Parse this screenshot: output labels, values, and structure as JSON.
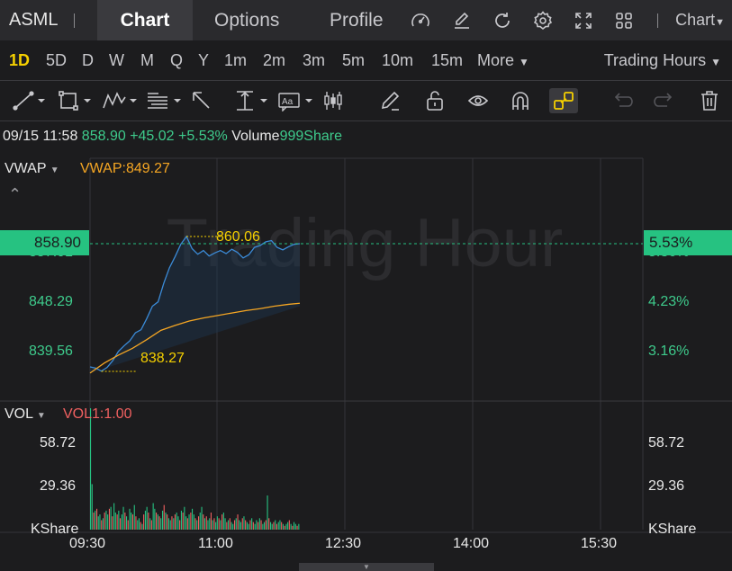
{
  "header": {
    "ticker": "ASML",
    "tabs": [
      "Chart",
      "Options",
      "Profile"
    ],
    "chart_type_label": "Chart",
    "icons": [
      "speedometer-icon",
      "pen-edit-icon",
      "refresh-icon",
      "gear-icon",
      "expand-icon",
      "grid-icon"
    ]
  },
  "periods": {
    "items": [
      "1D",
      "5D",
      "D",
      "W",
      "M",
      "Q",
      "Y",
      "1m",
      "2m",
      "3m",
      "5m",
      "10m",
      "15m",
      "More"
    ],
    "active": "1D",
    "hours_label": "Trading Hours"
  },
  "drawing_tools": [
    "trend-line-icon",
    "rectangle-icon",
    "wave-pattern-icon",
    "fibonacci-icon",
    "arrow-icon",
    "price-range-icon",
    "text-label-icon",
    "candlestick-icon",
    "pencil-icon",
    "unlock-icon",
    "eye-icon",
    "magnet-icon",
    "link-icon",
    "undo-icon",
    "redo-icon",
    "trash-icon"
  ],
  "quote": {
    "datetime": "09/15 11:58",
    "price": "858.90",
    "change": "+45.02",
    "change_pct": "+5.53%",
    "volume_label": "Volume",
    "volume_value": "999Share"
  },
  "price_panel": {
    "indicator": "VWAP",
    "vwap_label": "VWAP:849.27",
    "left_ticks": [
      "857.01",
      "848.29",
      "839.56"
    ],
    "right_ticks": [
      "5.36%",
      "4.23%",
      "3.16%"
    ],
    "current_price": "858.90",
    "current_pct": "5.53%",
    "high_label": "860.06",
    "low_label": "838.27",
    "watermark": "Trading Hour"
  },
  "volume_panel": {
    "indicator": "VOL",
    "vol_label": "VOL1:1.00",
    "left_ticks": [
      "58.72",
      "29.36",
      "KShare"
    ],
    "right_ticks": [
      "58.72",
      "29.36",
      "KShare"
    ]
  },
  "x_axis": [
    "09:30",
    "11:00",
    "12:30",
    "14:00",
    "15:30"
  ],
  "colors": {
    "up": "#26c281",
    "down": "#f06060",
    "price_line": "#3b8bd8",
    "vwap_line": "#f5a623",
    "active": "#f5d000"
  },
  "chart_data": [
    {
      "type": "line",
      "x_range": [
        "09:30",
        "16:00"
      ],
      "ylim": [
        835.5,
        862.5
      ],
      "current": 858.9,
      "high": 860.06,
      "low": 838.27,
      "series": [
        {
          "name": "VWAP",
          "x": [
            "09:30",
            "09:40",
            "09:50",
            "10:00",
            "10:10",
            "10:20",
            "10:30",
            "10:40",
            "10:50",
            "11:00",
            "11:10",
            "11:20",
            "11:30",
            "11:40",
            "11:50",
            "11:58"
          ],
          "values": [
            838.0,
            839.6,
            840.9,
            842.0,
            843.4,
            844.9,
            845.7,
            846.4,
            846.9,
            847.3,
            847.7,
            848.1,
            848.4,
            848.8,
            849.1,
            849.27
          ]
        },
        {
          "name": "Price",
          "x": [
            "09:30",
            "09:34",
            "09:38",
            "09:42",
            "09:46",
            "09:50",
            "09:54",
            "09:58",
            "10:02",
            "10:06",
            "10:10",
            "10:14",
            "10:18",
            "10:22",
            "10:26",
            "10:30",
            "10:34",
            "10:38",
            "10:42",
            "10:46",
            "10:50",
            "10:54",
            "10:58",
            "11:02",
            "11:06",
            "11:10",
            "11:14",
            "11:18",
            "11:22",
            "11:26",
            "11:30",
            "11:34",
            "11:38",
            "11:42",
            "11:46",
            "11:50",
            "11:54",
            "11:58"
          ],
          "values": [
            839.0,
            838.8,
            838.3,
            838.9,
            840.0,
            841.5,
            842.4,
            843.2,
            844.5,
            845.0,
            846.8,
            848.8,
            849.5,
            852.5,
            855.0,
            856.8,
            858.8,
            860.06,
            858.1,
            857.2,
            857.8,
            856.9,
            857.4,
            857.8,
            857.3,
            858.0,
            857.5,
            856.6,
            857.1,
            858.3,
            858.6,
            859.2,
            859.4,
            858.3,
            857.9,
            858.4,
            858.8,
            858.9
          ]
        }
      ]
    },
    {
      "type": "bar",
      "title": "VOL",
      "ylim": [
        0,
        64
      ],
      "note_unit": "KShare",
      "values": [
        64,
        24,
        9,
        10,
        11,
        7,
        8,
        5,
        6,
        9,
        10,
        8,
        11,
        12,
        7,
        14,
        9,
        8,
        10,
        6,
        8,
        12,
        9,
        7,
        5,
        11,
        9,
        8,
        13,
        7,
        5,
        6,
        4,
        3,
        8,
        10,
        12,
        9,
        6,
        5,
        14,
        11,
        9,
        8,
        7,
        6,
        10,
        13,
        9,
        8,
        6,
        5,
        7,
        6,
        8,
        9,
        7,
        5,
        10,
        9,
        12,
        7,
        6,
        8,
        9,
        11,
        8,
        6,
        5,
        7,
        9,
        12,
        8,
        6,
        7,
        5,
        6,
        9,
        5,
        6,
        4,
        7,
        6,
        5,
        8,
        9,
        6,
        4,
        5,
        6,
        4,
        3,
        5,
        6,
        8,
        5,
        4,
        6,
        7,
        5,
        4,
        3,
        5,
        6,
        4,
        3,
        5,
        4,
        6,
        5,
        3,
        4,
        5,
        18,
        6,
        4,
        3,
        4,
        5,
        3,
        4,
        5,
        4,
        3,
        2,
        3,
        4,
        5,
        3,
        2,
        4,
        3,
        2,
        3
      ]
    }
  ]
}
